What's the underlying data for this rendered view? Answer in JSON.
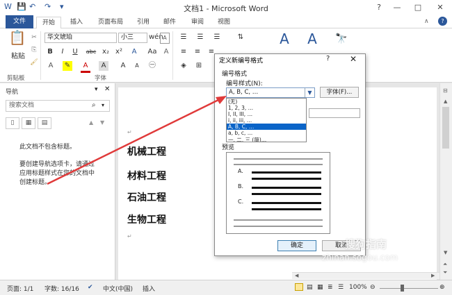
{
  "app": {
    "title": "文档1 - Microsoft Word",
    "help": "?",
    "minimize": "—",
    "restore": "□",
    "close": "✕"
  },
  "tabs": [
    "文件",
    "开始",
    "插入",
    "页面布局",
    "引用",
    "邮件",
    "审阅",
    "视图"
  ],
  "ribbon": {
    "paste_label": "粘贴",
    "clipboard_group": "剪贴板",
    "font_group": "字体",
    "font_name": "华文琥珀",
    "font_size": "小三",
    "bold": "B",
    "italic": "I",
    "underline": "U",
    "strike": "abc",
    "subscript": "x₂",
    "superscript": "x²",
    "grow_font": "A",
    "shrink_font": "A",
    "font_color": "A",
    "aa": "Aa",
    "wen": "wén",
    "clear": "A"
  },
  "nav": {
    "title": "导航",
    "search_placeholder": "搜索文档",
    "no_headings": "此文档不包含标题。",
    "help_line1": "要创建导航选项卡，请通过",
    "help_line2": "应用标题样式在您的文档中",
    "help_line3": "创建标题。"
  },
  "document": {
    "headings": [
      "机械工程",
      "材料工程",
      "石油工程",
      "生物工程"
    ]
  },
  "status": {
    "page": "页面: 1/1",
    "words": "字数: 16/16",
    "language": "中文(中国)",
    "mode": "插入",
    "zoom": "100%"
  },
  "dialog": {
    "title": "定义新编号格式",
    "help": "?",
    "close": "✕",
    "format_section": "编号格式",
    "style_label": "编号样式(N):",
    "style_value": "A, B, C, …",
    "font_button": "字体(F)...",
    "options": [
      "(无)",
      "1, 2, 3, …",
      "I, II, III, …",
      "i, ii, iii, …",
      "A, B, C, …",
      "a, b, c, …",
      "一, 二, 三 (简)…"
    ],
    "selected_index": 4,
    "preview_label": "预览",
    "preview_items": [
      "A.",
      "B.",
      "C."
    ],
    "ok": "确定",
    "cancel": "取消"
  },
  "watermark": {
    "brand": "搜狗指南",
    "url": "zhinan.sogou.com"
  },
  "colors": {
    "accent": "#2b579a",
    "arrow": "#e03a3a",
    "selection": "#0a64c8"
  }
}
